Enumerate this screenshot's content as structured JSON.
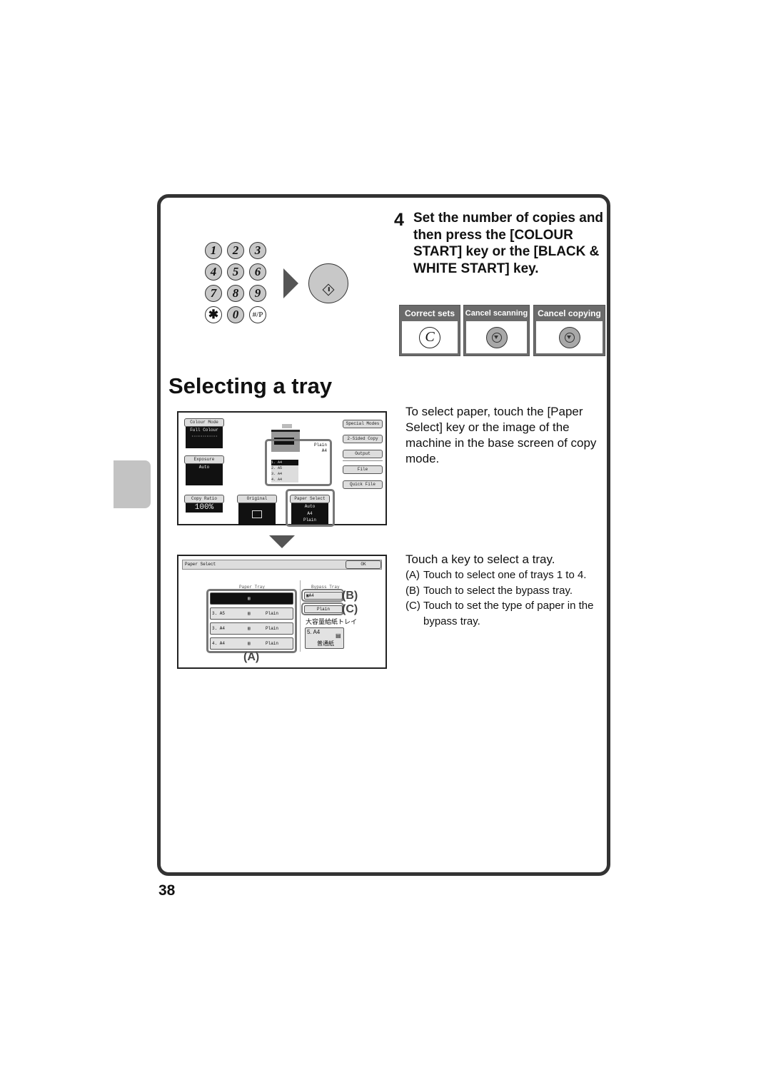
{
  "page_number": "38",
  "section_tab": "",
  "keypad": {
    "keys": [
      "1",
      "2",
      "3",
      "4",
      "5",
      "6",
      "7",
      "8",
      "9",
      "✱",
      "0",
      "#/P"
    ]
  },
  "start_key_icon": "start-diamond-icon",
  "step": {
    "number": "4",
    "text": "Set the number of copies and then press the [COLOUR START] key or the [BLACK & WHITE START] key."
  },
  "panels": [
    {
      "title": "Correct sets",
      "icon": "clear-c-icon",
      "symbol": "C"
    },
    {
      "title": "Cancel scanning",
      "icon": "stop-icon"
    },
    {
      "title": "Cancel copying",
      "icon": "stop-icon"
    }
  ],
  "heading": "Selecting a tray",
  "description1": "To select paper, touch the [Paper Select] key or the image of the machine in the base screen of copy mode.",
  "description2": {
    "lead": "Touch a key to select a tray.",
    "items": [
      {
        "label": "(A)",
        "text": "Touch to select one of trays 1 to 4."
      },
      {
        "label": "(B)",
        "text": "Touch to select the bypass tray."
      },
      {
        "label": "(C)",
        "text": "Touch to set the type of paper in the bypass tray."
      }
    ]
  },
  "base_screen": {
    "colour_mode": {
      "label": "Colour Mode",
      "value": "Full Colour"
    },
    "exposure": {
      "label": "Exposure",
      "value": "Auto"
    },
    "copy_ratio": {
      "label": "Copy Ratio",
      "value": "100%"
    },
    "original": {
      "label": "Original"
    },
    "paper_select": {
      "label": "Paper Select",
      "values": [
        "Auto",
        "A4",
        "Plain"
      ]
    },
    "right_buttons": [
      "Special Modes",
      "2-Sided Copy",
      "Output",
      "File",
      "Quick File"
    ],
    "machine_bypass": {
      "type": "Plain",
      "size": "A4"
    },
    "machine_trays": [
      {
        "num": "1.",
        "size": "A4"
      },
      {
        "num": "2.",
        "size": "A5"
      },
      {
        "num": "3.",
        "size": "A4"
      },
      {
        "num": "4.",
        "size": "A4"
      }
    ]
  },
  "paper_select_screen": {
    "title": "Paper Select",
    "ok": "OK",
    "paper_tray_label": "Paper Tray",
    "bypass_tray_label": "Bypass Tray",
    "trays": [
      {
        "name": "",
        "type": "",
        "selected": true
      },
      {
        "name": "3. A5",
        "type": "Plain",
        "selected": false
      },
      {
        "name": "3. A4",
        "type": "Plain",
        "selected": false
      },
      {
        "name": "4. A4",
        "type": "Plain",
        "selected": false
      }
    ],
    "bypass_size": "A4",
    "bypass_type": "Plain",
    "lcc_label": "大容量給紙トレイ",
    "lcc_tray": {
      "name": "5. A4",
      "type": "普通紙"
    },
    "callouts": {
      "a": "(A)",
      "b": "(B)",
      "c": "(C)"
    }
  }
}
